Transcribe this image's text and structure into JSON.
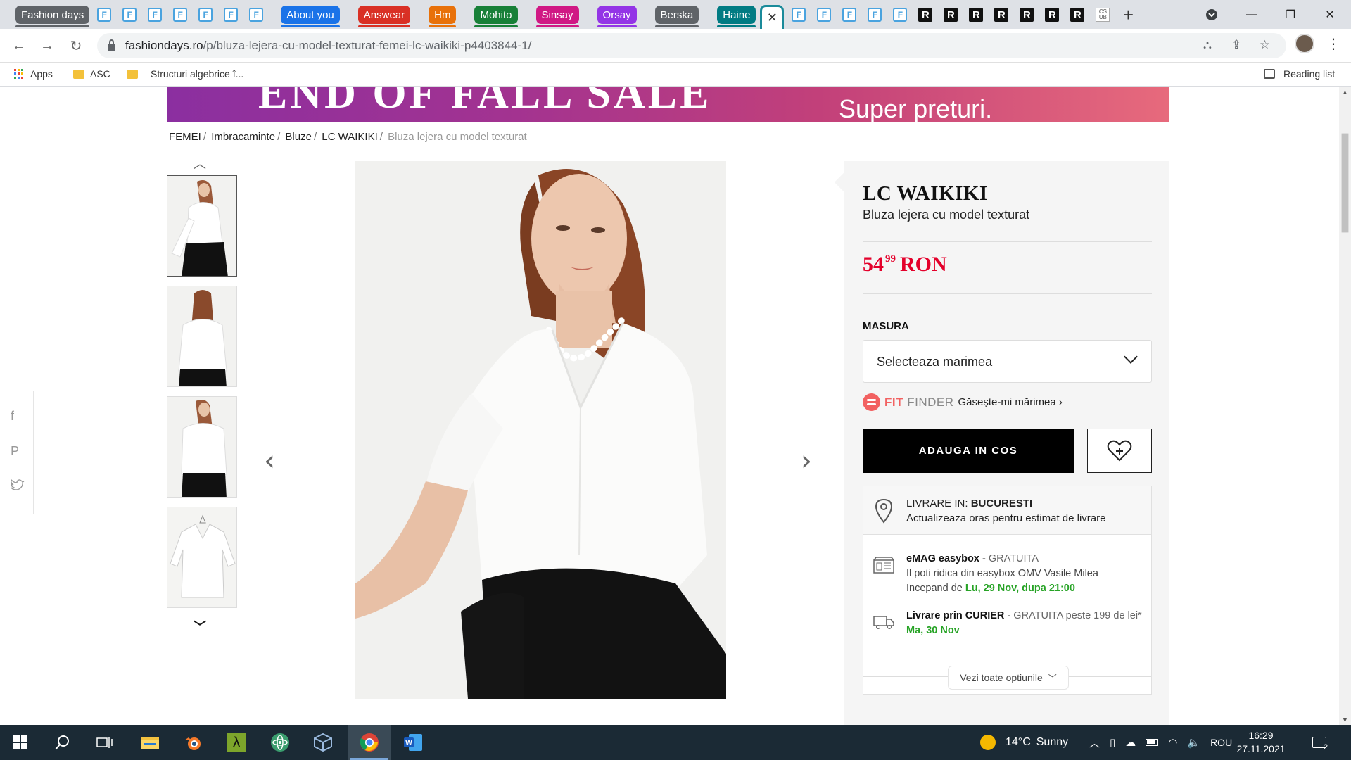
{
  "browser": {
    "tab_groups": [
      {
        "label": "Fashion days",
        "color": "#5f6368"
      },
      {
        "label": "About you",
        "color": "#1a73e8"
      },
      {
        "label": "Answear",
        "color": "#d93025"
      },
      {
        "label": "Hm",
        "color": "#e8710a"
      },
      {
        "label": "Mohito",
        "color": "#188038"
      },
      {
        "label": "Sinsay",
        "color": "#d01884"
      },
      {
        "label": "Orsay",
        "color": "#9334e6"
      },
      {
        "label": "Berska",
        "color": "#5f6368"
      },
      {
        "label": "Haine",
        "color": "#007b83"
      }
    ],
    "favicon_labels": {
      "fashiondays": "F",
      "reserved": "R",
      "csub": "CS UB"
    },
    "active_tab_close": "✕",
    "new_tab": "+",
    "window_controls": {
      "minimize": "—",
      "maximize": "❐",
      "close": "✕"
    },
    "url_host": "fashiondays.ro",
    "url_path": "/p/bluza-lejera-cu-model-texturat-femei-lc-waikiki-p4403844-1/",
    "bookmarks": [
      {
        "label": "Apps",
        "icon": "apps-grid-icon"
      },
      {
        "label": "ASC",
        "icon": "folder-icon"
      },
      {
        "label": "Structuri algebrice î...",
        "icon": "folder-icon"
      }
    ],
    "reading_list": "Reading list"
  },
  "page": {
    "banner_left": "END OF FALL SALE",
    "banner_right": "Super preturi.",
    "breadcrumbs": [
      "FEMEI",
      "Imbracaminte",
      "Bluze",
      "LC WAIKIKI"
    ],
    "breadcrumb_current": "Bluza lejera cu model texturat",
    "social": [
      "f",
      "P",
      "t"
    ],
    "product": {
      "brand": "LC WAIKIKI",
      "name": "Bluza lejera cu model texturat",
      "price_int": "54",
      "price_dec": "99",
      "currency": "RON",
      "size_label": "MASURA",
      "size_placeholder": "Selecteaza marimea",
      "fit_brand_a": "FIT",
      "fit_brand_b": "FINDER",
      "fit_link": "Găsește-mi mărimea ›",
      "add_to_cart": "ADAUGA IN COS"
    },
    "delivery": {
      "label": "LIVRARE IN:",
      "city": "BUCURESTI",
      "update": "Actualizeaza oras pentru estimat de livrare",
      "options": [
        {
          "title": "eMAG easybox",
          "tag": " - GRATUITA",
          "line2": "Il poti ridica din easybox OMV Vasile Milea",
          "line3_prefix": "Incepand de ",
          "line3_date": "Lu, 29 Nov, dupa 21:00"
        },
        {
          "title": "Livrare prin CURIER",
          "tag": " - GRATUITA peste 199 de lei*",
          "line3_date": "Ma, 30 Nov"
        }
      ],
      "see_all": "Vezi toate optiunile"
    }
  },
  "taskbar": {
    "weather_temp": "14°C",
    "weather_desc": "Sunny",
    "language": "ROU",
    "time": "16:29",
    "date": "27.11.2021",
    "notifications": "2"
  },
  "colors": {
    "price": "#e4002b",
    "green": "#27a326",
    "fit": "#f26161",
    "taskbar": "#1b2a35"
  }
}
